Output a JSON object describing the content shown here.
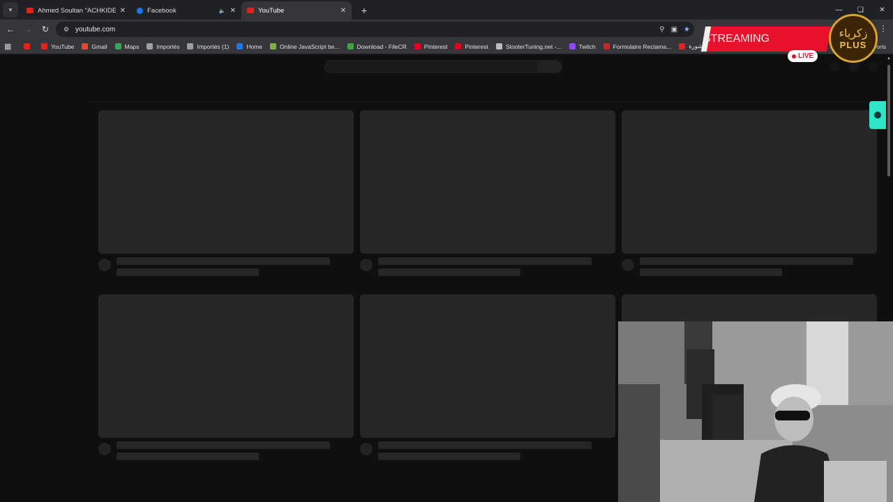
{
  "browser": {
    "tabs": [
      {
        "title": "Ahmed Soultan \"ACHKIDE feat...",
        "favicon_color": "#e62117",
        "active": false,
        "audio": false
      },
      {
        "title": "Facebook",
        "favicon_color": "#1877f2",
        "active": false,
        "audio": true
      },
      {
        "title": "YouTube",
        "favicon_color": "#e62117",
        "active": true,
        "audio": false
      }
    ],
    "url": "youtube.com",
    "bookmarks": [
      {
        "label": "",
        "color": "#e62117"
      },
      {
        "label": "YouTube",
        "color": "#e62117"
      },
      {
        "label": "Gmail",
        "color": "#ea4335"
      },
      {
        "label": "Maps",
        "color": "#34a853"
      },
      {
        "label": "Importés",
        "color": "#9aa0a6"
      },
      {
        "label": "Importés (1)",
        "color": "#9aa0a6"
      },
      {
        "label": "Home",
        "color": "#1877f2"
      },
      {
        "label": "Online JavaScript be...",
        "color": "#7cb342"
      },
      {
        "label": "Download - FileCR",
        "color": "#43a047"
      },
      {
        "label": "Pinterest",
        "color": "#e60023"
      },
      {
        "label": "Pinterest",
        "color": "#e60023"
      },
      {
        "label": "StooterTuning.net -...",
        "color": "#bdbdbd"
      },
      {
        "label": "Twitch",
        "color": "#9146ff"
      },
      {
        "label": "Formulaire Reclama...",
        "color": "#c62828"
      },
      {
        "label": "ت المنشورة",
        "color": "#e62117"
      }
    ],
    "bookmarks_more": "voris"
  },
  "overlay": {
    "streaming_text": "STREAMING",
    "live_text": "LIVE",
    "logo_text_ar": "زكرياء",
    "logo_text_plus": "PLUS"
  },
  "colors": {
    "accent_red": "#e8102a",
    "page_bg": "#0f0f0f",
    "skeleton": "#272727",
    "widget": "#2ee6c8"
  }
}
